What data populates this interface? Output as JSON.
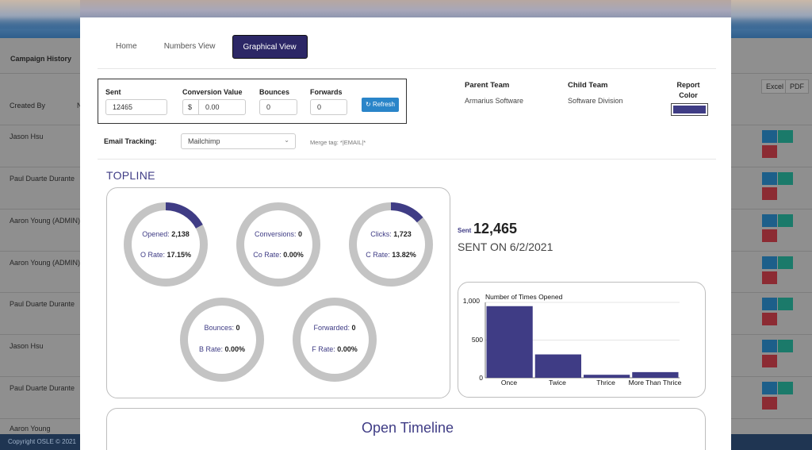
{
  "background": {
    "section_title": "Campaign History",
    "columns": [
      "Created By",
      "N"
    ],
    "export_buttons": [
      "Excel",
      "PDF"
    ],
    "rows": [
      {
        "created_by": "Jason Hsu"
      },
      {
        "created_by": "Paul Duarte Durante"
      },
      {
        "created_by": "Aaron Young (ADMIN)"
      },
      {
        "created_by": "Aaron Young (ADMIN)"
      },
      {
        "created_by": "Paul Duarte Durante"
      },
      {
        "created_by": "Jason Hsu"
      },
      {
        "created_by": "Paul Duarte Durante"
      },
      {
        "created_by": "Aaron Young"
      }
    ],
    "footer": "Copyright OSLE © 2021"
  },
  "modal": {
    "tabs": [
      {
        "label": "Home",
        "active": false
      },
      {
        "label": "Numbers View",
        "active": false
      },
      {
        "label": "Graphical View",
        "active": true
      }
    ],
    "inputs": {
      "sent": {
        "label": "Sent",
        "value": "12465"
      },
      "conversion": {
        "label": "Conversion Value",
        "prefix": "$",
        "value": "0.00"
      },
      "bounces": {
        "label": "Bounces",
        "value": "0"
      },
      "forwards": {
        "label": "Forwards",
        "value": "0"
      },
      "refresh_label": "Refresh"
    },
    "parent_team": {
      "label": "Parent Team",
      "value": "Armarius Software"
    },
    "child_team": {
      "label": "Child Team",
      "value": "Software Division"
    },
    "report_color": {
      "label": "Report Color",
      "color": "#3f3c85"
    },
    "email_tracking": {
      "label": "Email Tracking:",
      "value": "Mailchimp",
      "merge_tag": "Merge tag: *|EMAIL|*"
    },
    "topline_title": "TOPLINE",
    "donuts": [
      {
        "name": "opened",
        "label": "Opened:",
        "value": "2,138",
        "rate_label": "O Rate:",
        "rate": "17.15%",
        "fraction": 0.1715
      },
      {
        "name": "conversions",
        "label": "Conversions:",
        "value": "0",
        "rate_label": "Co Rate:",
        "rate": "0.00%",
        "fraction": 0
      },
      {
        "name": "clicks",
        "label": "Clicks:",
        "value": "1,723",
        "rate_label": "C Rate:",
        "rate": "13.82%",
        "fraction": 0.1382
      },
      {
        "name": "bounces",
        "label": "Bounces:",
        "value": "0",
        "rate_label": "B Rate:",
        "rate": "0.00%",
        "fraction": 0
      },
      {
        "name": "forwarded",
        "label": "Forwarded:",
        "value": "0",
        "rate_label": "F Rate:",
        "rate": "0.00%",
        "fraction": 0
      }
    ],
    "sent_summary": {
      "small": "Sent",
      "count": "12,465",
      "sent_on": "SENT ON 6/2/2021"
    },
    "open_timeline_title": "Open Timeline",
    "colors": {
      "accent": "#3f3c85",
      "ring": "#c4c4c4",
      "tab_active": "#2c2766",
      "refresh": "#2a85c9"
    }
  },
  "chart_data": {
    "type": "bar",
    "title": "Number of Times Opened",
    "categories": [
      "Once",
      "Twice",
      "Thrice",
      "More Than Thrice"
    ],
    "values": [
      950,
      310,
      40,
      75
    ],
    "ylim": [
      0,
      1000
    ],
    "yticks": [
      "0",
      "500",
      "1,000"
    ],
    "xlabel": "",
    "ylabel": "",
    "grid": true
  }
}
